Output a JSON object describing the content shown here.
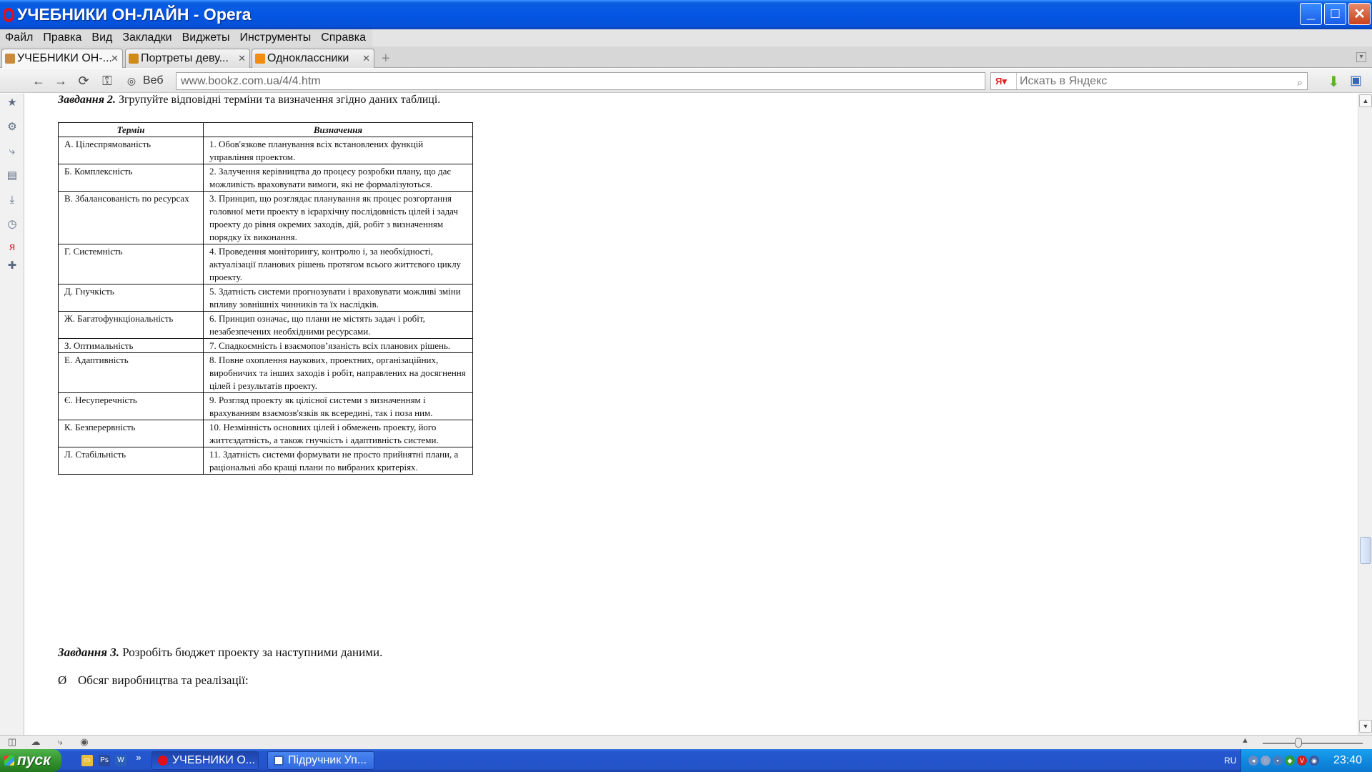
{
  "window": {
    "title": "УЧЕБНИКИ ОН-ЛАЙН - Opera",
    "controls": {
      "minimize": "_",
      "maximize": "□",
      "close": "✕"
    }
  },
  "menu": [
    "Файл",
    "Правка",
    "Вид",
    "Закладки",
    "Виджеты",
    "Инструменты",
    "Справка"
  ],
  "tabs": [
    {
      "label": "УЧЕБНИКИ ОН-...",
      "active": true,
      "icon": "book-icon",
      "color": "#c98a3a"
    },
    {
      "label": "Портреты деву...",
      "active": false,
      "icon": "grid-icon",
      "color": "#d08a1a"
    },
    {
      "label": "Одноклассники",
      "active": false,
      "icon": "ok-icon",
      "color": "#f28c12"
    }
  ],
  "address": {
    "web_label": "Веб",
    "url": "www.bookz.com.ua/4/4.htm",
    "search_placeholder": "Искать в Яндекс",
    "search_engine": "Я"
  },
  "content": {
    "task2": {
      "label": "Завдання 2.",
      "text": " Згрупуйте відповідні терміни та визначення згідно даних таблиці."
    },
    "table": {
      "headers": [
        "Термін",
        "Визначення"
      ],
      "rows": [
        {
          "term": "А.  Цілеспрямованість",
          "definition": "1. Обов'язкове планування всіх встановлених функцій управління проектом."
        },
        {
          "term": "Б.  Комплексність",
          "definition": "2. Залучення керівництва до процесу розробки плану, що дає можливість враховувати вимоги, які не формалізуються."
        },
        {
          "term": "В.  Збалансованість по ресурсах",
          "definition": "3. Принцип, що розглядає планування як процес розгортання головної мети проекту в ієрархічну послідовність цілей і задач проекту до рівня окремих заходів, дій, робіт з визначенням порядку їх виконання."
        },
        {
          "term": "Г.  Системність",
          "definition": "4. Проведення моніторингу, контролю і, за необхідності, актуалізації планових рішень протягом всього життєвого циклу проекту."
        },
        {
          "term": "Д.  Гнучкість",
          "definition": "5. Здатність системи прогнозувати і враховувати можливі зміни впливу зовнішніх чинників та їх наслідків."
        },
        {
          "term": "Ж.  Багатофункціональність",
          "definition": "6. Принцип означає, що плани не містять задач і робіт, незабезпечених необхідними ресурсами."
        },
        {
          "term": "З.  Оптимальність",
          "definition": "7. Спадкоємність і взаємопов’язаність всіх планових рішень."
        },
        {
          "term": "Е.  Адаптивність",
          "definition": "8. Повне охоплення наукових, проектних, організаційних, виробничих та інших заходів і робіт, направлених на досягнення цілей і результатів проекту."
        },
        {
          "term": "Є.  Несуперечність",
          "definition": "9. Розгляд проекту як цілісної системи з визначенням і врахуванням взаємозв'язків як всередині, так і поза ним."
        },
        {
          "term": "К.  Безперервність",
          "definition": "10. Незмінність основних цілей і обмежень проекту, його життєздатність, а також гнучкість і адаптивність системи."
        },
        {
          "term": "Л.  Стабільність",
          "definition": "11. Здатність системи формувати не просто прийнятні плани, а раціональні або кращі плани по вибраних критеріях."
        }
      ]
    },
    "task3": {
      "label": "Завдання 3.",
      "text": " Розробіть бюджет проекту за наступними даними."
    },
    "bullet": {
      "symbol": "Ø",
      "text": "Обсяг виробництва та реалізації:"
    }
  },
  "taskbar": {
    "start_label": "пуск",
    "tasks": [
      {
        "label": "УЧЕБНИКИ О...",
        "active": true,
        "icon_color": "#e2101a"
      },
      {
        "label": "Підручник Уп...",
        "active": false,
        "icon_color": "#2b5fb8"
      }
    ],
    "lang": "RU",
    "clock": "23:40"
  }
}
